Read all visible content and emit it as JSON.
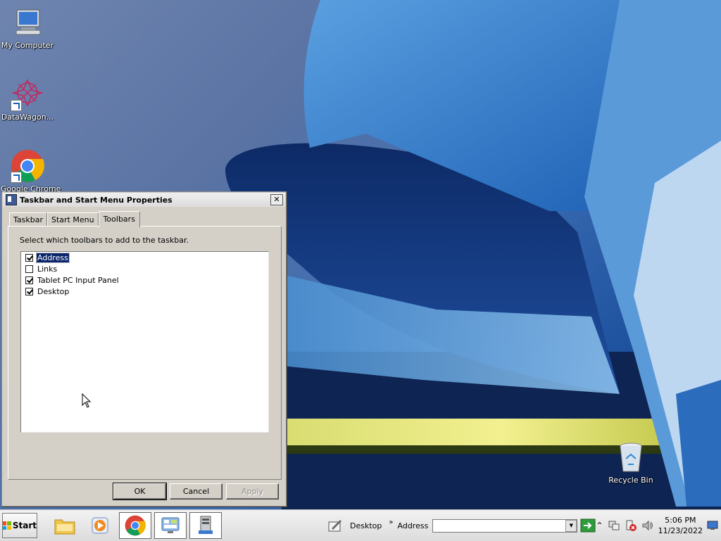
{
  "desktop": {
    "icons": [
      {
        "label": "My Computer"
      },
      {
        "label": "DataWagon..."
      },
      {
        "label": "Google Chrome"
      },
      {
        "label": "Recycle Bin"
      }
    ]
  },
  "dialog": {
    "title": "Taskbar and Start Menu Properties",
    "close_label": "✕",
    "tabs": [
      {
        "label": "Taskbar"
      },
      {
        "label": "Start Menu"
      },
      {
        "label": "Toolbars"
      }
    ],
    "active_tab": "Toolbars",
    "instruction": "Select which toolbars to add to the taskbar.",
    "toolbars": [
      {
        "label": "Address",
        "checked": true,
        "selected": true
      },
      {
        "label": "Links",
        "checked": false,
        "selected": false
      },
      {
        "label": "Tablet PC Input Panel",
        "checked": true,
        "selected": false
      },
      {
        "label": "Desktop",
        "checked": true,
        "selected": false
      }
    ],
    "buttons": {
      "ok": "OK",
      "cancel": "Cancel",
      "apply": "Apply"
    }
  },
  "taskbar": {
    "start_label": "Start",
    "desktop_toolbar": "Desktop",
    "chevron": "»",
    "address_label": "Address",
    "address_value": "",
    "time": "5:06 PM",
    "date": "11/23/2022"
  },
  "colors": {
    "selection": "#0a246a",
    "dialog_face": "#d4d0c8"
  }
}
